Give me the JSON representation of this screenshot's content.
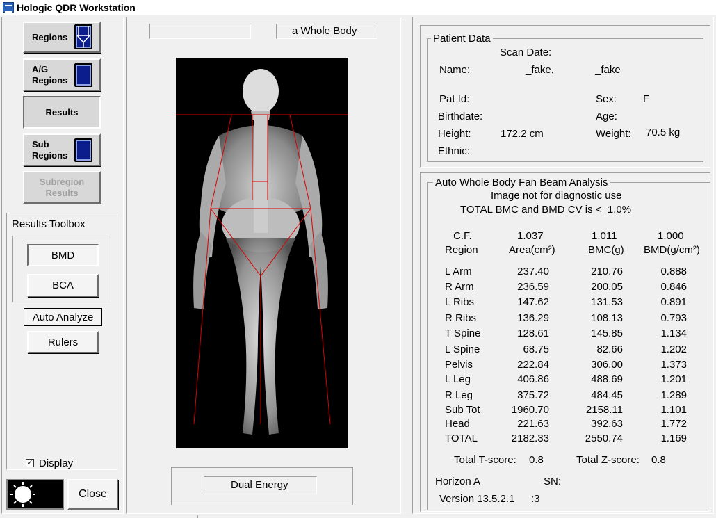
{
  "window": {
    "title": "Hologic QDR Workstation"
  },
  "left": {
    "buttons": [
      {
        "label": "Regions"
      },
      {
        "label": "A/G\nRegions"
      },
      {
        "label": "Results"
      },
      {
        "label": "Sub\nRegions"
      },
      {
        "label": "Subregion\nResults"
      }
    ],
    "toolbox_title": "Results Toolbox",
    "bmd_label": "BMD",
    "bca_label": "BCA",
    "auto_analyze_label": "Auto Analyze",
    "rulers_label": "Rulers",
    "display_label": "Display",
    "close_label": "Close"
  },
  "center": {
    "scan_label": "a Whole Body",
    "energy_label": "Dual Energy"
  },
  "patient": {
    "title": "Patient Data",
    "scan_date_label": "Scan Date:",
    "name_label": "Name:",
    "name_first": "_fake,",
    "name_last": "_fake",
    "pat_id_label": "Pat Id:",
    "sex_label": "Sex:",
    "sex_value": "F",
    "birthdate_label": "Birthdate:",
    "age_label": "Age:",
    "height_label": "Height:",
    "height_value": "172.2 cm",
    "weight_label": "Weight:",
    "weight_value": "70.5 kg",
    "ethnic_label": "Ethnic:"
  },
  "analysis": {
    "title": "Auto Whole Body Fan Beam Analysis",
    "note": "Image not for diagnostic use",
    "cv_note": "TOTAL BMC and BMD CV is <  1.0%",
    "cf_label": "C.F.",
    "cf_area": "1.037",
    "cf_bmc": "1.011",
    "cf_bmd": "1.000",
    "col_region": "Region",
    "col_area": "Area(cm²)",
    "col_bmc": "BMC(g)",
    "col_bmd": "BMD(g/cm²)",
    "rows": [
      {
        "region": "L Arm",
        "area": "237.40",
        "bmc": "210.76",
        "bmd": "0.888"
      },
      {
        "region": "R Arm",
        "area": "236.59",
        "bmc": "200.05",
        "bmd": "0.846"
      },
      {
        "region": "L Ribs",
        "area": "147.62",
        "bmc": "131.53",
        "bmd": "0.891"
      },
      {
        "region": "R Ribs",
        "area": "136.29",
        "bmc": "108.13",
        "bmd": "0.793"
      },
      {
        "region": "T Spine",
        "area": "128.61",
        "bmc": "145.85",
        "bmd": "1.134"
      },
      {
        "region": "L Spine",
        "area": "68.75",
        "bmc": "82.66",
        "bmd": "1.202"
      },
      {
        "region": "Pelvis",
        "area": "222.84",
        "bmc": "306.00",
        "bmd": "1.373"
      },
      {
        "region": "L Leg",
        "area": "406.86",
        "bmc": "488.69",
        "bmd": "1.201"
      },
      {
        "region": "R Leg",
        "area": "375.72",
        "bmc": "484.45",
        "bmd": "1.289"
      },
      {
        "region": "Sub Tot",
        "area": "1960.70",
        "bmc": "2158.11",
        "bmd": "1.101"
      },
      {
        "region": "Head",
        "area": "221.63",
        "bmc": "392.63",
        "bmd": "1.772"
      },
      {
        "region": "TOTAL",
        "area": "2182.33",
        "bmc": "2550.74",
        "bmd": "1.169"
      }
    ],
    "t_score_label": "Total T-score:",
    "t_score_value": "0.8",
    "z_score_label": "Total Z-score:",
    "z_score_value": "0.8",
    "device_label": "Horizon A",
    "sn_label": "SN:",
    "version_label": "Version 13.5.2.1",
    "version_suffix": ":3"
  },
  "colors": {
    "region_lines": "#e00000",
    "region_icon": "#0b1c8c"
  }
}
